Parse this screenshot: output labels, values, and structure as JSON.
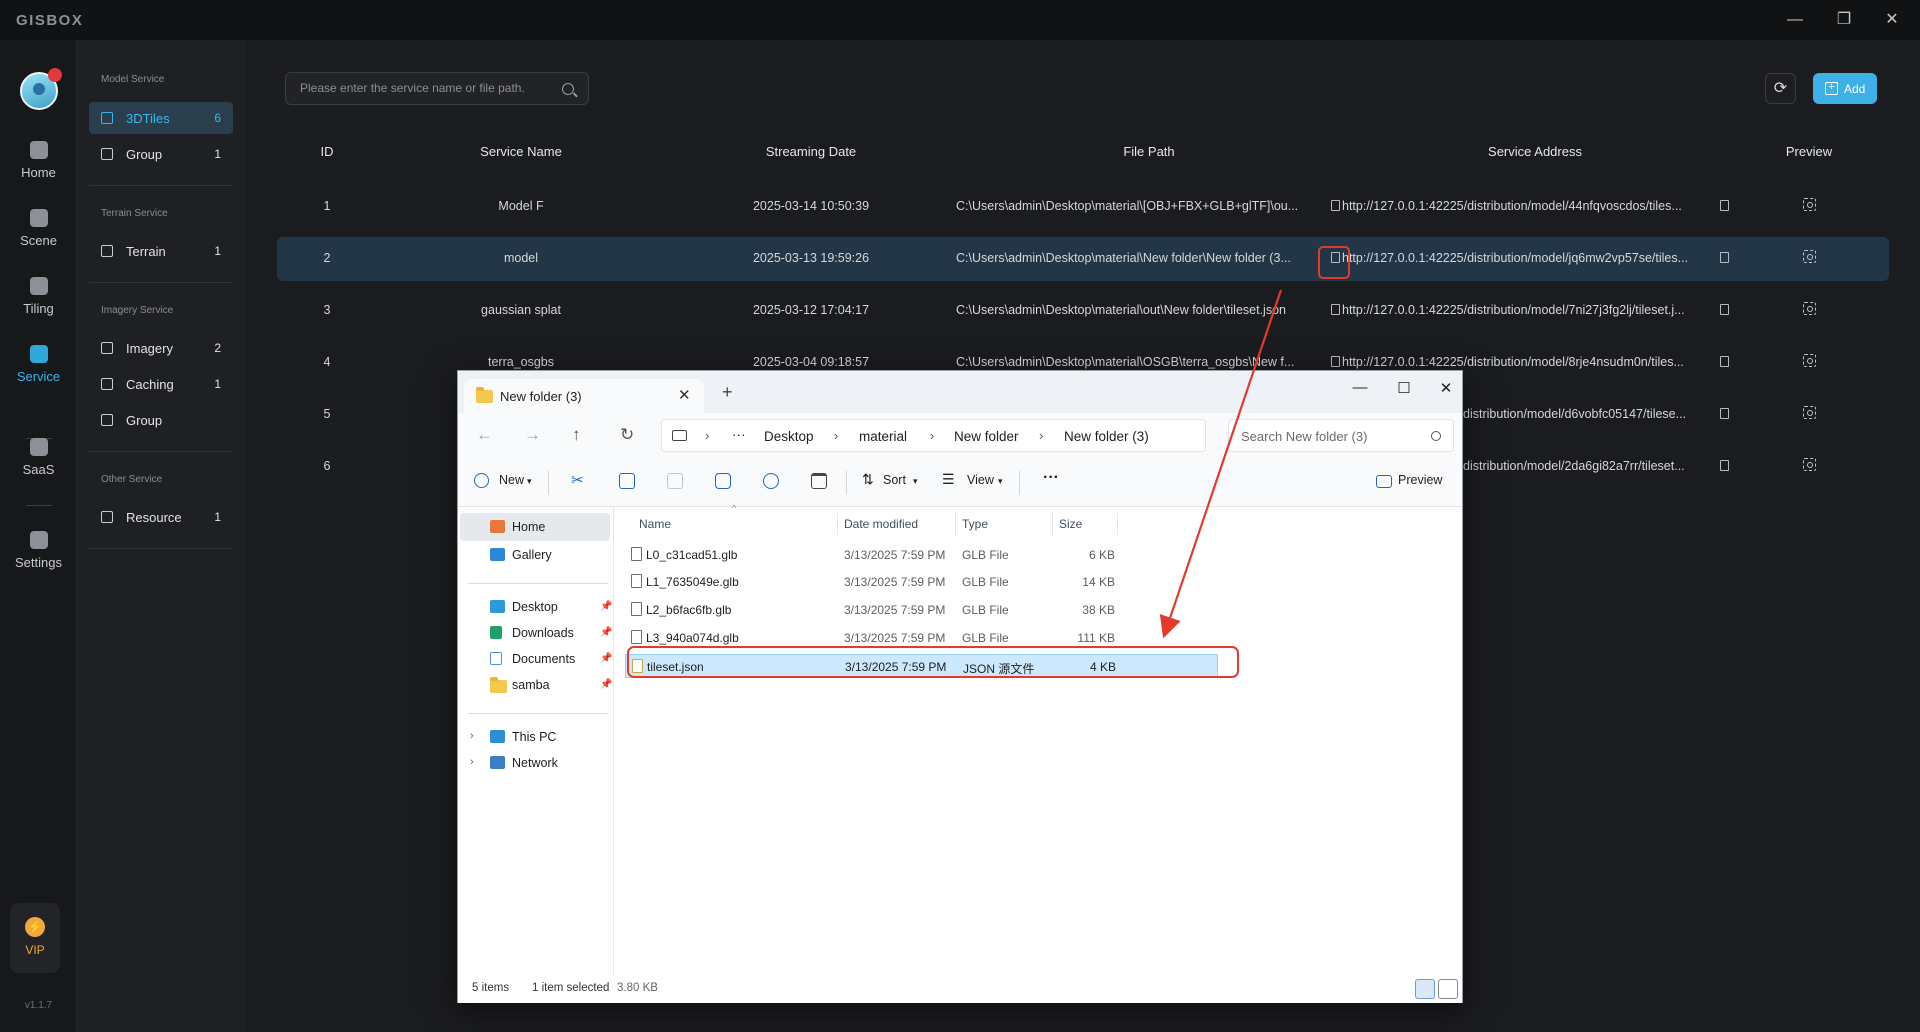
{
  "app": {
    "logo": "GISBOX",
    "version": "v1.1.7",
    "window_controls": {
      "minimize": "—",
      "restore": "❐",
      "close": "✕"
    }
  },
  "leftnav": [
    {
      "label": "Home",
      "icon": "home-icon"
    },
    {
      "label": "Scene",
      "icon": "scene-icon"
    },
    {
      "label": "Tiling",
      "icon": "tiling-icon"
    },
    {
      "label": "Service",
      "icon": "service-icon",
      "active": true
    },
    {
      "label": "SaaS",
      "icon": "saas-icon"
    },
    {
      "label": "Settings",
      "icon": "settings-icon"
    }
  ],
  "vip": {
    "label": "VIP",
    "icon": "lightning-icon",
    "glyph": "⚡"
  },
  "sidebar": {
    "model_section": "Model Service",
    "model_items": [
      {
        "label": "3DTiles",
        "count": "6",
        "active": true
      },
      {
        "label": "Group",
        "count": "1"
      }
    ],
    "terrain_section": "Terrain Service",
    "terrain_items": [
      {
        "label": "Terrain",
        "count": "1"
      }
    ],
    "imagery_section": "Imagery Service",
    "imagery_items": [
      {
        "label": "Imagery",
        "count": "2"
      },
      {
        "label": "Caching",
        "count": "1"
      },
      {
        "label": "Group",
        "count": ""
      }
    ],
    "other_section": "Other Service",
    "other_items": [
      {
        "label": "Resource",
        "count": "1"
      }
    ]
  },
  "toolbar": {
    "search_placeholder": "Please enter the service name or file path.",
    "refresh_glyph": "⟳",
    "add_label": "Add",
    "add_glyph": "+"
  },
  "table": {
    "headers": [
      "ID",
      "Service Name",
      "Streaming Date",
      "File Path",
      "Service Address",
      "Preview"
    ],
    "rows": [
      {
        "id": "1",
        "name": "Model F",
        "date": "2025-03-14 10:50:39",
        "path": "C:\\Users\\admin\\Desktop\\material\\[OBJ+FBX+GLB+glTF]\\ou...",
        "address": "http://127.0.0.1:42225/distribution/model/44nfqvoscdos/tiles..."
      },
      {
        "id": "2",
        "name": "model",
        "date": "2025-03-13 19:59:26",
        "path": "C:\\Users\\admin\\Desktop\\material\\New folder\\New folder (3...",
        "address": "http://127.0.0.1:42225/distribution/model/jq6mw2vp57se/tiles...",
        "selected": true
      },
      {
        "id": "3",
        "name": "gaussian splat",
        "date": "2025-03-12 17:04:17",
        "path": "C:\\Users\\admin\\Desktop\\material\\out\\New folder\\tileset.json",
        "address": "http://127.0.0.1:42225/distribution/model/7ni27j3fg2lj/tileset.j..."
      },
      {
        "id": "4",
        "name": "terra_osgbs",
        "date": "2025-03-04 09:18:57",
        "path": "C:\\Users\\admin\\Desktop\\material\\OSGB\\terra_osgbs\\New f...",
        "address": "http://127.0.0.1:42225/distribution/model/8rje4nsudm0n/tiles..."
      },
      {
        "id": "5",
        "name": "",
        "date": "",
        "path": "",
        "address": "distribution/model/d6vobfc05147/tilese..."
      },
      {
        "id": "6",
        "name": "",
        "date": "",
        "path": "",
        "address": "distribution/model/2da6gi82a7rr/tileset..."
      }
    ]
  },
  "explorer": {
    "tab_title": "New folder (3)",
    "tab_close": "✕",
    "new_tab": "+",
    "window_controls": {
      "minimize": "—",
      "maximize": "☐",
      "close": "✕"
    },
    "nav_glyphs": {
      "back": "←",
      "forward": "→",
      "up": "↑",
      "refresh": "↻",
      "more": "···"
    },
    "breadcrumbs": [
      "Desktop",
      "material",
      "New folder",
      "New folder (3)"
    ],
    "search_placeholder": "Search New folder (3)",
    "commands": {
      "new": "New",
      "sort": "Sort",
      "view": "View",
      "more": "···",
      "preview": "Preview"
    },
    "nav_pane": {
      "quick": [
        {
          "label": "Home",
          "selected": true
        },
        {
          "label": "Gallery"
        }
      ],
      "pinned": [
        {
          "label": "Desktop"
        },
        {
          "label": "Downloads"
        },
        {
          "label": "Documents"
        },
        {
          "label": "samba"
        }
      ],
      "locations": [
        {
          "label": "This PC"
        },
        {
          "label": "Network"
        }
      ]
    },
    "columns": [
      "Name",
      "Date modified",
      "Type",
      "Size"
    ],
    "files": [
      {
        "name": "L0_c31cad51.glb",
        "date": "3/13/2025 7:59 PM",
        "type": "GLB File",
        "size": "6 KB"
      },
      {
        "name": "L1_7635049e.glb",
        "date": "3/13/2025 7:59 PM",
        "type": "GLB File",
        "size": "14 KB"
      },
      {
        "name": "L2_b6fac6fb.glb",
        "date": "3/13/2025 7:59 PM",
        "type": "GLB File",
        "size": "38 KB"
      },
      {
        "name": "L3_940a074d.glb",
        "date": "3/13/2025 7:59 PM",
        "type": "GLB File",
        "size": "111 KB"
      },
      {
        "name": "tileset.json",
        "date": "3/13/2025 7:59 PM",
        "type": "JSON 源文件",
        "size": "4 KB",
        "selected": true
      }
    ],
    "status": {
      "items": "5 items",
      "selected": "1 item selected",
      "size": "3.80 KB"
    }
  },
  "colors": {
    "accent": "#3fb0e6",
    "highlight": "#e23b2e",
    "selected_row": "#223647"
  }
}
